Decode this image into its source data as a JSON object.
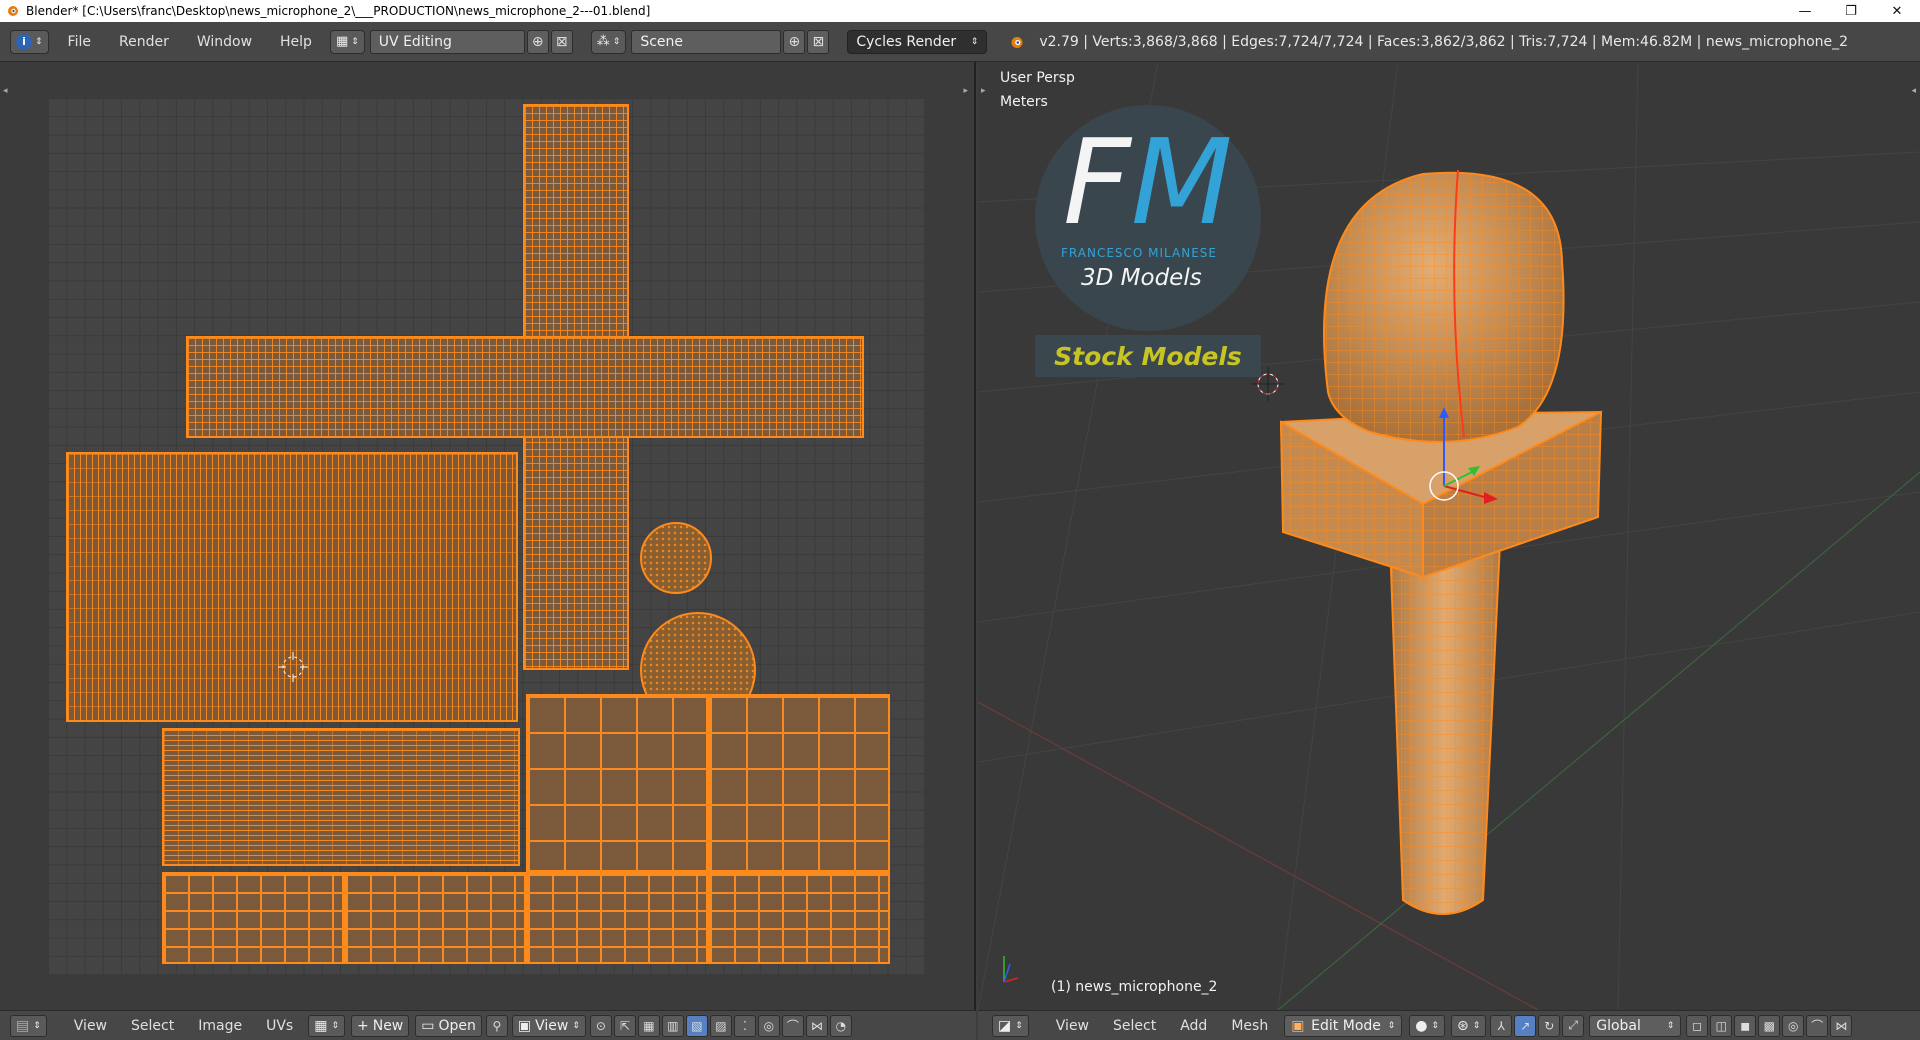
{
  "window": {
    "title": "Blender* [C:\\Users\\franc\\Desktop\\news_microphone_2\\___PRODUCTION\\news_microphone_2---01.blend]",
    "minimize": "—",
    "maximize": "❐",
    "close": "✕"
  },
  "top_menu": {
    "items": [
      "File",
      "Render",
      "Window",
      "Help"
    ],
    "screen_layout": "UV Editing",
    "scene": "Scene",
    "render_engine": "Cycles Render",
    "stats": "v2.79 | Verts:3,868/3,868 | Edges:7,724/7,724 | Faces:3,862/3,862 | Tris:7,724 | Mem:46.82M | news_microphone_2"
  },
  "viewport": {
    "view_name": "User Persp",
    "units": "Meters",
    "object_label": "(1) news_microphone_2",
    "watermark": {
      "brand_left": "F",
      "brand_right": "M",
      "brand_name": "FRANCESCO MILANESE",
      "tagline": "3D Models",
      "badge": "Stock Models"
    }
  },
  "uv_header": {
    "menus": [
      "View",
      "Select",
      "Image",
      "UVs"
    ],
    "new_label": "New",
    "open_label": "Open",
    "view_label": "View"
  },
  "viewport_header": {
    "menus": [
      "View",
      "Select",
      "Add",
      "Mesh"
    ],
    "mode": "Edit Mode",
    "orientation": "Global"
  },
  "colors": {
    "selection": "#ff8a1a",
    "mesh_fill": "#c98a45",
    "accent_blue": "#5680c2"
  }
}
